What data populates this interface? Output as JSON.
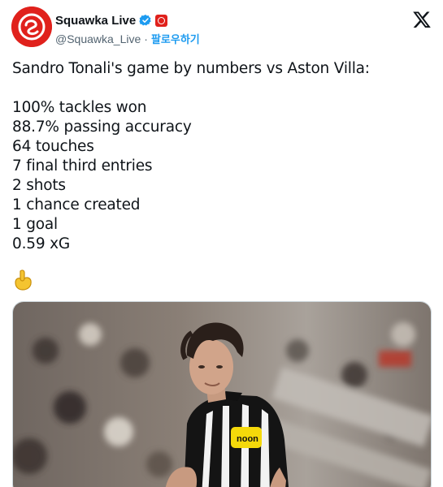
{
  "account": {
    "display_name": "Squawka Live",
    "handle": "@Squawka_Live",
    "separator": "·",
    "follow_label": "팔로우하기",
    "brand_color": "#e0211c",
    "verified_color": "#1d9bf0"
  },
  "icons": {
    "verified": "verified-badge-icon",
    "affiliate": "affiliate-badge-icon",
    "platform": "x-logo-icon",
    "emoji": "pinching-hand-emoji"
  },
  "tweet": {
    "intro": "Sandro Tonali's game by numbers vs Aston Villa:",
    "stats": [
      "100% tackles won",
      "88.7% passing accuracy",
      "64 touches",
      "7 final third entries",
      "2 shots",
      "1 chance created",
      "1 goal",
      "0.59 xG"
    ],
    "emoji": "👌"
  },
  "media": {
    "sponsor_text": "noon",
    "description_kind": "photo"
  }
}
